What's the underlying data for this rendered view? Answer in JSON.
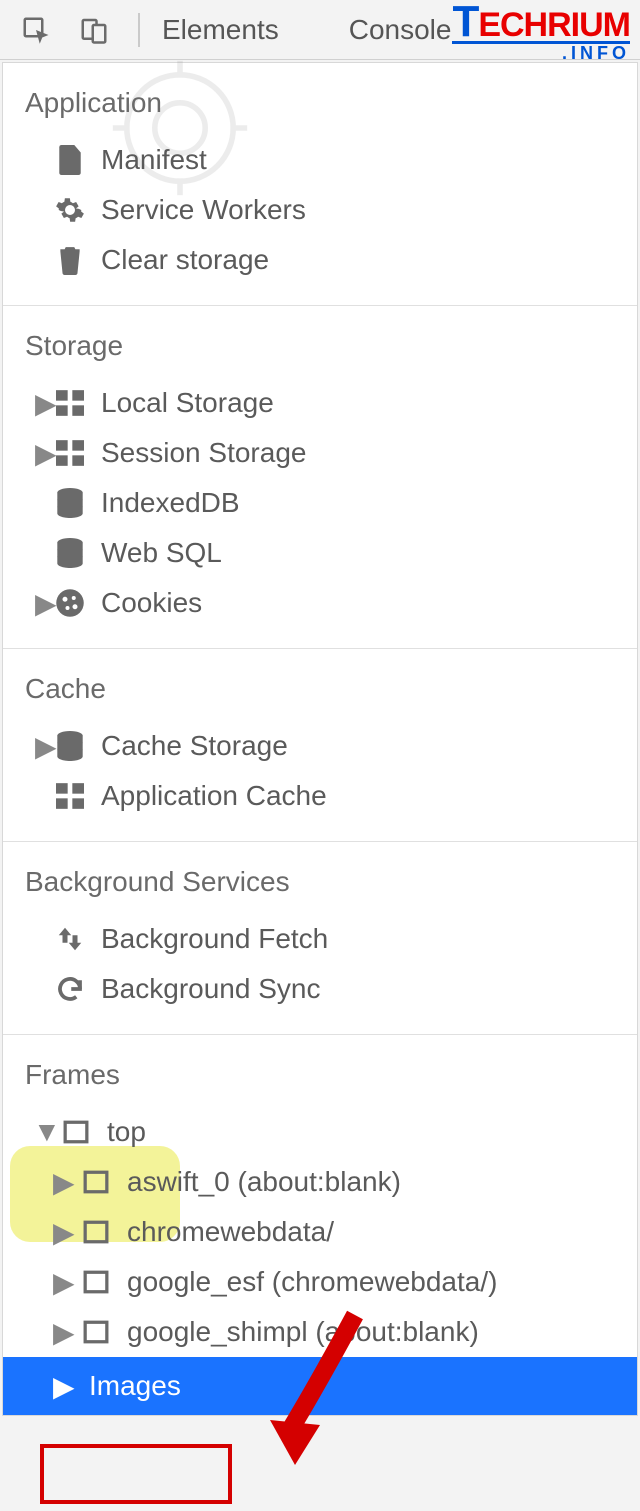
{
  "toolbar": {
    "tabs": [
      "Elements",
      "Console"
    ]
  },
  "logo": {
    "brand": "TECHRIUM",
    "sub": ".INFO"
  },
  "sections": {
    "application": {
      "title": "Application",
      "items": [
        {
          "name": "manifest",
          "label": "Manifest",
          "icon": "file",
          "expandable": false
        },
        {
          "name": "service-workers",
          "label": "Service Workers",
          "icon": "gear",
          "expandable": false
        },
        {
          "name": "clear-storage",
          "label": "Clear storage",
          "icon": "trash",
          "expandable": false
        }
      ]
    },
    "storage": {
      "title": "Storage",
      "items": [
        {
          "name": "local-storage",
          "label": "Local Storage",
          "icon": "grid",
          "expandable": true
        },
        {
          "name": "session-storage",
          "label": "Session Storage",
          "icon": "grid",
          "expandable": true
        },
        {
          "name": "indexeddb",
          "label": "IndexedDB",
          "icon": "db",
          "expandable": false
        },
        {
          "name": "web-sql",
          "label": "Web SQL",
          "icon": "db",
          "expandable": false
        },
        {
          "name": "cookies",
          "label": "Cookies",
          "icon": "cookie",
          "expandable": true
        }
      ]
    },
    "cache": {
      "title": "Cache",
      "items": [
        {
          "name": "cache-storage",
          "label": "Cache Storage",
          "icon": "db",
          "expandable": true
        },
        {
          "name": "application-cache",
          "label": "Application Cache",
          "icon": "grid",
          "expandable": false
        }
      ]
    },
    "bg": {
      "title": "Background Services",
      "items": [
        {
          "name": "bg-fetch",
          "label": "Background Fetch",
          "icon": "updown",
          "expandable": false
        },
        {
          "name": "bg-sync",
          "label": "Background Sync",
          "icon": "sync",
          "expandable": false
        }
      ]
    },
    "frames": {
      "title": "Frames",
      "top": "top",
      "children": [
        {
          "label": "aswift_0 (about:blank)"
        },
        {
          "label": "chromewebdata/"
        },
        {
          "label": "google_esf (chromewebdata/)"
        },
        {
          "label": "google_shimpl (about:blank)"
        }
      ],
      "images": "Images"
    }
  }
}
